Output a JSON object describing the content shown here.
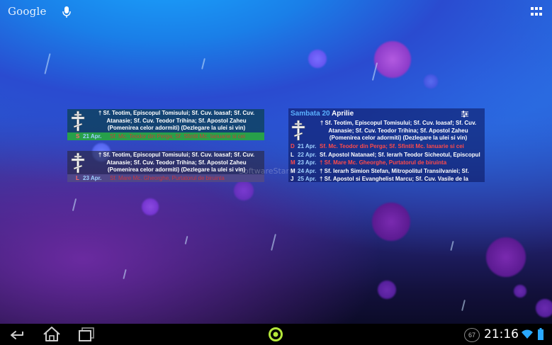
{
  "topbar": {
    "google_label": "Google",
    "mic_icon": "mic-icon",
    "apps_icon": "apps-grid-icon"
  },
  "widget_small_1": {
    "saints_lines": [
      "† Sf. Teotim, Episcopul Tomisului; Sf. Cuv. Ioasaf; Sf. Cuv.",
      "Atanasie; Sf. Cuv. Teodor Trihina; Sf. Apostol Zaheu",
      "(Pomenirea celor adormiti) (Dezlegare la ulei si vin)"
    ],
    "bar_day": "S",
    "bar_date": "21 Apr.",
    "bar_text": "Sf. Mc. Teodor din Perga; Sf. Sfintit Mc. Ianuarie si cei"
  },
  "widget_small_2": {
    "saints_lines": [
      "† Sf. Teotim, Episcopul Tomisului; Sf. Cuv. Ioasaf; Sf. Cuv.",
      "Atanasie; Sf. Cuv. Teodor Trihina; Sf. Apostol Zaheu",
      "(Pomenirea celor adormiti) (Dezlegare la ulei si vin)"
    ],
    "bar_day": "L",
    "bar_date": "23 Apr.",
    "bar_text": "Sf. Mare Mc. Gheorghe, Purtatorul de biruinta"
  },
  "widget_big": {
    "title_day": "Sambata",
    "title_num": "20",
    "title_month": "Aprilie",
    "settings_icon": "settings-icon",
    "saints_lines": [
      "† Sf. Teotim, Episcopul Tomisului; Sf. Cuv. Ioasaf; Sf. Cuv.",
      "Atanasie; Sf. Cuv. Teodor Trihina; Sf. Apostol Zaheu",
      "(Pomenirea celor adormiti) (Dezlegare la ulei si vin)"
    ],
    "rows": [
      {
        "d": "D",
        "date": "21 Apr.",
        "text": "Sf. Mc. Teodor din Perga; Sf. Sfintit Mc. Ianuarie si cei",
        "red": true
      },
      {
        "d": "L",
        "date": "22 Apr.",
        "text": "Sf. Apostol Natanael; Sf. Ierarh Teodor Sicheotul, Episcopul",
        "red": false
      },
      {
        "d": "M",
        "date": "23 Apr.",
        "text": "† Sf. Mare Mc. Gheorghe, Purtatorul de biruinta",
        "red": true
      },
      {
        "d": "M",
        "date": "24 Apr.",
        "text": "† Sf. Ierarh Simion Stefan, Mitropolitul Transilvaniei; Sf.",
        "red": false
      },
      {
        "d": "J",
        "date": "25 Apr.",
        "text": "† Sf. Apostol si Evanghelist Marcu; Sf. Cuv. Vasile de la",
        "red": false
      }
    ]
  },
  "watermark": "SoftwareStars.org",
  "statusbar": {
    "badge": "67",
    "time": "21:16",
    "wifi_icon": "wifi-icon",
    "battery_icon": "battery-icon"
  },
  "navbar": {
    "back_icon": "back-icon",
    "home_icon": "home-icon",
    "recents_icon": "recents-icon",
    "center_icon": "launcher-ring-icon"
  }
}
